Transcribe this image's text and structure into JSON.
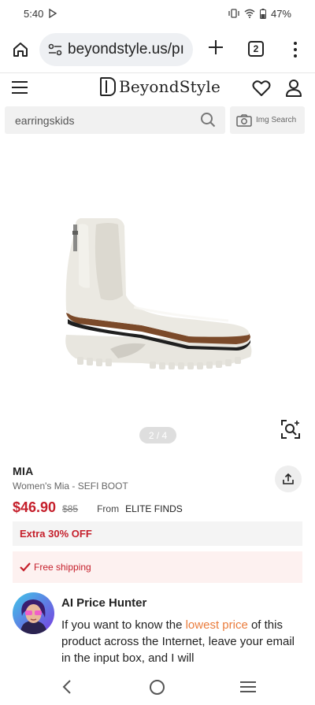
{
  "status_bar": {
    "time": "5:40",
    "battery": "47%",
    "icons": [
      "play-store-icon",
      "vibrate-icon",
      "wifi-icon",
      "battery-icon"
    ]
  },
  "browser": {
    "url": "beyondstyle.us/pı",
    "tab_count": "2"
  },
  "site": {
    "logo_text": "BeyondStyle",
    "search_value": "earringskids",
    "img_search_label": "Img Search"
  },
  "gallery": {
    "indicator": "2 / 4"
  },
  "product": {
    "brand": "MIA",
    "name": "Women's Mia - SEFI BOOT",
    "price": "$46.90",
    "original_price": "$85",
    "from_label": "From",
    "seller": "ELITE FINDS",
    "discount": "Extra 30% OFF",
    "shipping": "Free shipping"
  },
  "ai_hunter": {
    "title": "AI Price Hunter",
    "text_before": "If you want to know the ",
    "highlight": "lowest price",
    "text_after": " of this product across the Internet, leave your email in the input box, and I will"
  },
  "colors": {
    "price_red": "#c51f2b",
    "highlight_orange": "#ea7c3c",
    "shipping_bg": "#fdf1f0"
  }
}
